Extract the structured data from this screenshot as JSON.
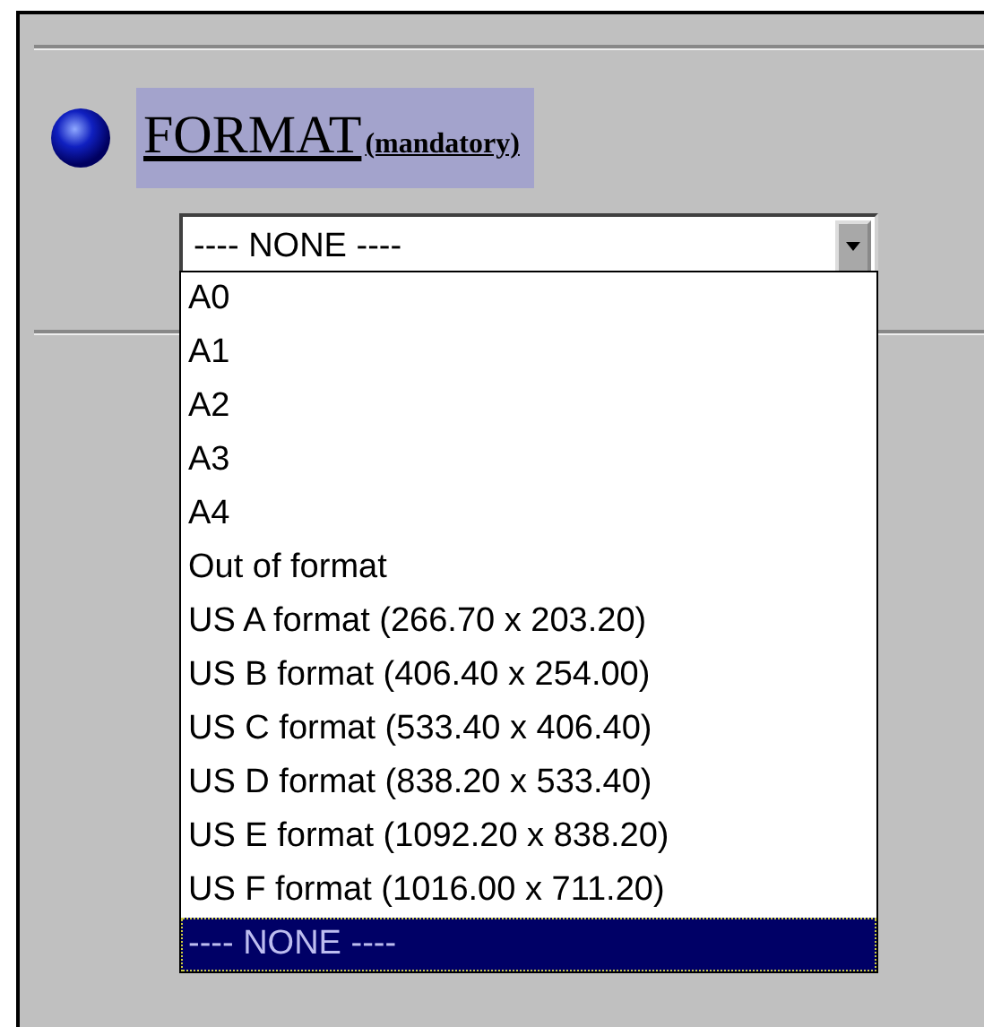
{
  "field": {
    "label": "FORMAT",
    "note": "(mandatory)"
  },
  "select": {
    "value": "---- NONE ----"
  },
  "options": [
    {
      "label": "A0",
      "selected": false
    },
    {
      "label": "A1",
      "selected": false
    },
    {
      "label": "A2",
      "selected": false
    },
    {
      "label": "A3",
      "selected": false
    },
    {
      "label": "A4",
      "selected": false
    },
    {
      "label": "Out of format",
      "selected": false
    },
    {
      "label": "US A format (266.70 x 203.20)",
      "selected": false
    },
    {
      "label": "US B format (406.40 x 254.00)",
      "selected": false
    },
    {
      "label": "US C format (533.40 x 406.40)",
      "selected": false
    },
    {
      "label": "US D format (838.20 x 533.40)",
      "selected": false
    },
    {
      "label": "US E format (1092.20 x 838.20)",
      "selected": false
    },
    {
      "label": "US F format (1016.00 x 711.20)",
      "selected": false
    },
    {
      "label": "---- NONE ----",
      "selected": true
    }
  ]
}
